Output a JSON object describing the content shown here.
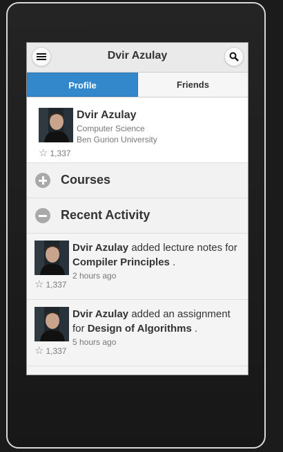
{
  "header": {
    "title": "Dvir Azulay"
  },
  "tabs": [
    {
      "label": "Profile",
      "active": true
    },
    {
      "label": "Friends",
      "active": false
    }
  ],
  "profile": {
    "name": "Dvir Azulay",
    "department": "Computer Science",
    "university": "Ben Gurion University",
    "stars": "1,337"
  },
  "sections": {
    "courses": "Courses",
    "recent_activity": "Recent Activity"
  },
  "activities": [
    {
      "user": "Dvir Azulay",
      "action": "added lecture notes for",
      "target": "Compiler Principles",
      "end": ".",
      "time": "2 hours ago",
      "stars": "1,337"
    },
    {
      "user": "Dvir Azulay",
      "action": "added an assignment for",
      "target": "Design of Algorithms",
      "end": ".",
      "time": "5 hours ago",
      "stars": "1,337"
    }
  ],
  "colors": {
    "accent": "#3388cc",
    "background": "#1b1b1b"
  },
  "icons": {
    "menu": "menu-icon",
    "search": "search-icon",
    "star": "star-icon",
    "expand": "plus-circle-icon",
    "collapse": "minus-circle-icon"
  }
}
